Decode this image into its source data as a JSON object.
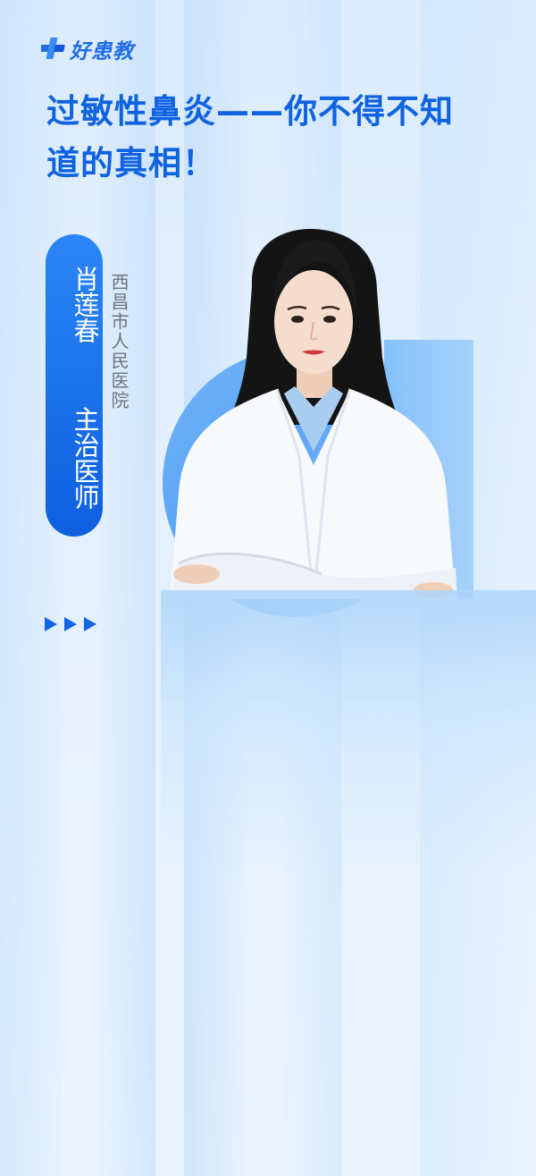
{
  "brand": {
    "logo_text": "好患教",
    "icon": "medical-cross-logo-icon",
    "color": "#1e6ee6"
  },
  "title": {
    "line1": "过敏性鼻炎——你不得不知",
    "line2": "道的真相！",
    "color": "#0f62e0"
  },
  "doctor": {
    "name": "肖莲春",
    "role": "主治医师",
    "hospital": "西昌市人民医院",
    "portrait": "doctor-portrait-illustration"
  },
  "decorations": {
    "arrows_icon": "triple-play-arrows-icon",
    "accent_color": "#1266e3"
  }
}
